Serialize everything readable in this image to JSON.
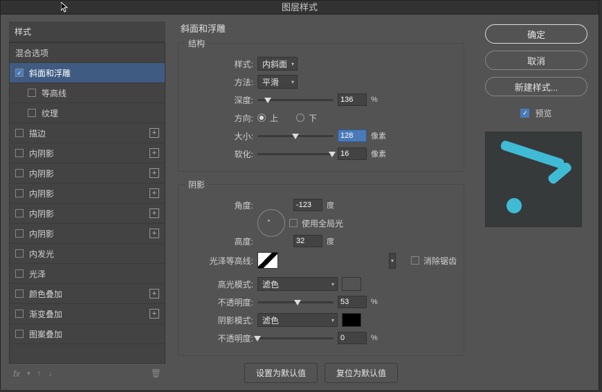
{
  "title": "图层样式",
  "sidebar": {
    "header": "样式",
    "blending": "混合选项",
    "items": [
      {
        "label": "斜面和浮雕",
        "checked": true,
        "selected": true,
        "add": false,
        "sub": false
      },
      {
        "label": "等高线",
        "checked": false,
        "selected": false,
        "add": false,
        "sub": true
      },
      {
        "label": "纹理",
        "checked": false,
        "selected": false,
        "add": false,
        "sub": true
      },
      {
        "label": "描边",
        "checked": false,
        "selected": false,
        "add": true,
        "sub": false
      },
      {
        "label": "内阴影",
        "checked": false,
        "selected": false,
        "add": true,
        "sub": false
      },
      {
        "label": "内阴影",
        "checked": false,
        "selected": false,
        "add": true,
        "sub": false
      },
      {
        "label": "内阴影",
        "checked": false,
        "selected": false,
        "add": true,
        "sub": false
      },
      {
        "label": "内阴影",
        "checked": false,
        "selected": false,
        "add": true,
        "sub": false
      },
      {
        "label": "内阴影",
        "checked": false,
        "selected": false,
        "add": true,
        "sub": false
      },
      {
        "label": "内发光",
        "checked": false,
        "selected": false,
        "add": false,
        "sub": false
      },
      {
        "label": "光泽",
        "checked": false,
        "selected": false,
        "add": false,
        "sub": false
      },
      {
        "label": "颜色叠加",
        "checked": false,
        "selected": false,
        "add": true,
        "sub": false
      },
      {
        "label": "渐变叠加",
        "checked": false,
        "selected": false,
        "add": true,
        "sub": false
      },
      {
        "label": "图案叠加",
        "checked": false,
        "selected": false,
        "add": false,
        "sub": false
      }
    ],
    "fx": "fx"
  },
  "main": {
    "section": "斜面和浮雕",
    "structure": {
      "legend": "结构",
      "style_label": "样式:",
      "style_value": "内斜面",
      "method_label": "方法:",
      "method_value": "平滑",
      "depth_label": "深度:",
      "depth_value": "136",
      "depth_unit": "%",
      "direction_label": "方向:",
      "direction_up": "上",
      "direction_down": "下",
      "size_label": "大小:",
      "size_value": "128",
      "size_unit": "像素",
      "soften_label": "软化:",
      "soften_value": "16",
      "soften_unit": "像素"
    },
    "shading": {
      "legend": "阴影",
      "angle_label": "角度:",
      "angle_value": "-123",
      "angle_unit": "度",
      "global_light": "使用全局光",
      "altitude_label": "高度:",
      "altitude_value": "32",
      "altitude_unit": "度",
      "gloss_label": "光泽等高线:",
      "antialias": "消除锯齿",
      "highlight_mode_label": "高光模式:",
      "highlight_mode_value": "滤色",
      "highlight_color": "#26b9f0",
      "highlight_opacity_label": "不透明度:",
      "highlight_opacity_value": "53",
      "highlight_opacity_unit": "%",
      "shadow_mode_label": "阴影模式:",
      "shadow_mode_value": "滤色",
      "shadow_color": "#000000",
      "shadow_opacity_label": "不透明度:",
      "shadow_opacity_value": "0",
      "shadow_opacity_unit": "%"
    },
    "buttons": {
      "default": "设置为默认值",
      "reset": "复位为默认值"
    }
  },
  "right": {
    "ok": "确定",
    "cancel": "取消",
    "new_style": "新建样式...",
    "preview": "预览"
  }
}
